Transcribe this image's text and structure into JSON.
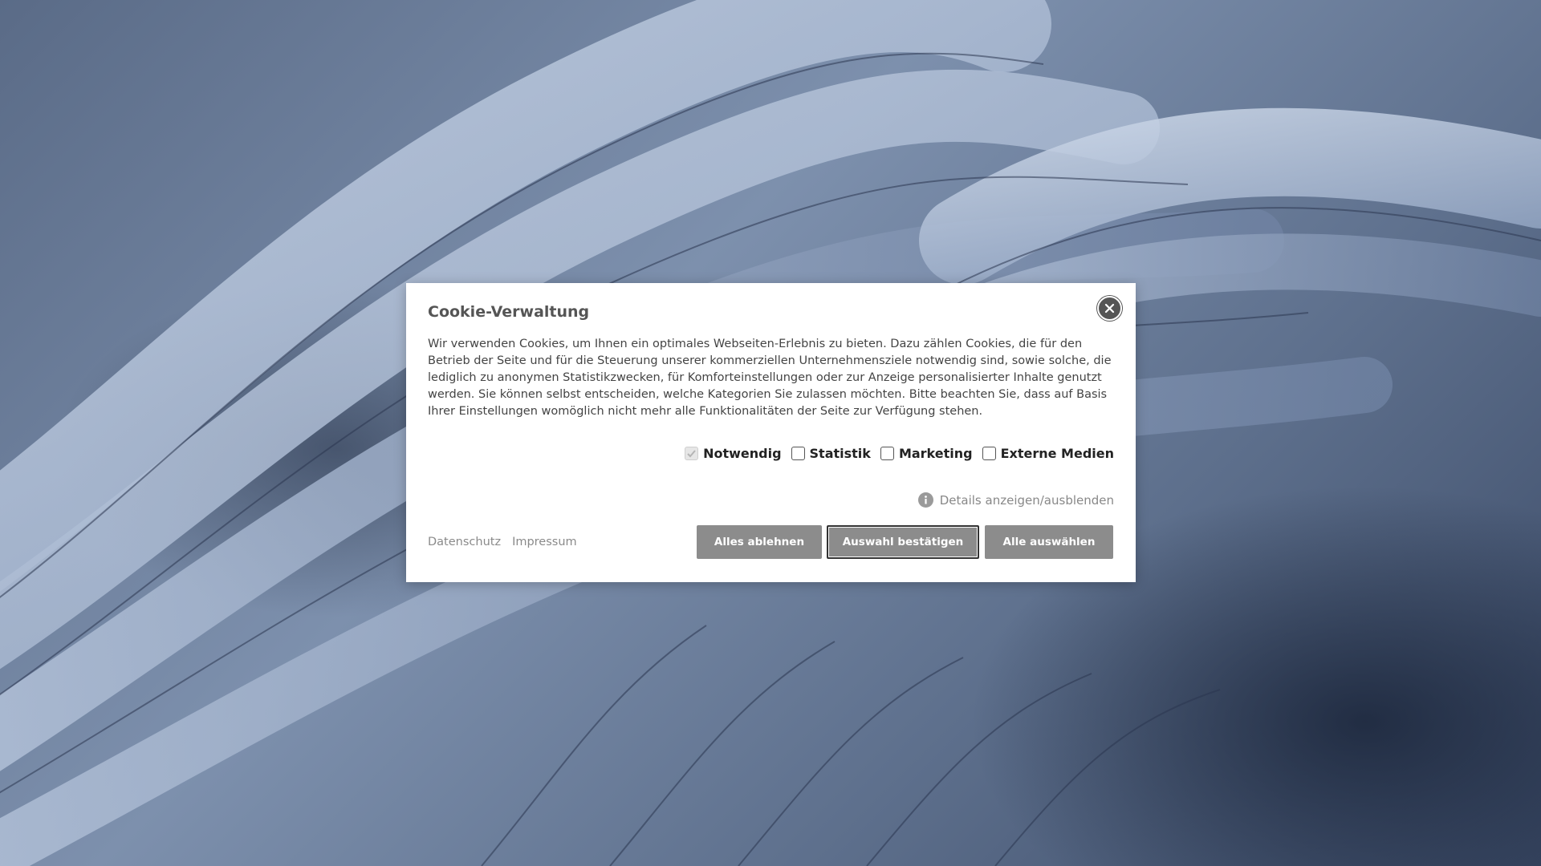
{
  "background": {
    "colors": {
      "light": "#b9c6db",
      "mid": "#7d90ad",
      "dark": "#2e3a52"
    }
  },
  "modal": {
    "title": "Cookie-Verwaltung",
    "close_icon": "close-icon",
    "text": "Wir verwenden Cookies, um Ihnen ein optimales Webseiten-Erlebnis zu bieten. Dazu zählen Cookies, die für den Betrieb der Seite und für die Steuerung unserer kommerziellen Unternehmensziele notwendig sind, sowie solche, die lediglich zu anonymen Statistikzwecken, für Komforteinstellungen oder zur Anzeige personalisierter Inhalte genutzt werden. Sie können selbst entscheiden, welche Kategorien Sie zulassen möchten. Bitte beachten Sie, dass auf Basis Ihrer Einstellungen womöglich nicht mehr alle Funktionalitäten der Seite zur Verfügung stehen.",
    "options": [
      {
        "label": "Notwendig",
        "checked": true,
        "disabled": true
      },
      {
        "label": "Statistik",
        "checked": false,
        "disabled": false
      },
      {
        "label": "Marketing",
        "checked": false,
        "disabled": false
      },
      {
        "label": "Externe Medien",
        "checked": false,
        "disabled": false
      }
    ],
    "details_label": "Details anzeigen/ausblenden",
    "details_icon": "info-icon",
    "links": {
      "privacy": "Datenschutz",
      "imprint": "Impressum"
    },
    "buttons": {
      "reject": "Alles ablehnen",
      "confirm": "Auswahl bestätigen",
      "accept_all": "Alle auswählen"
    },
    "colors": {
      "button_bg": "#8c8c8c",
      "title": "#555555",
      "link": "#8a8a8a"
    }
  }
}
